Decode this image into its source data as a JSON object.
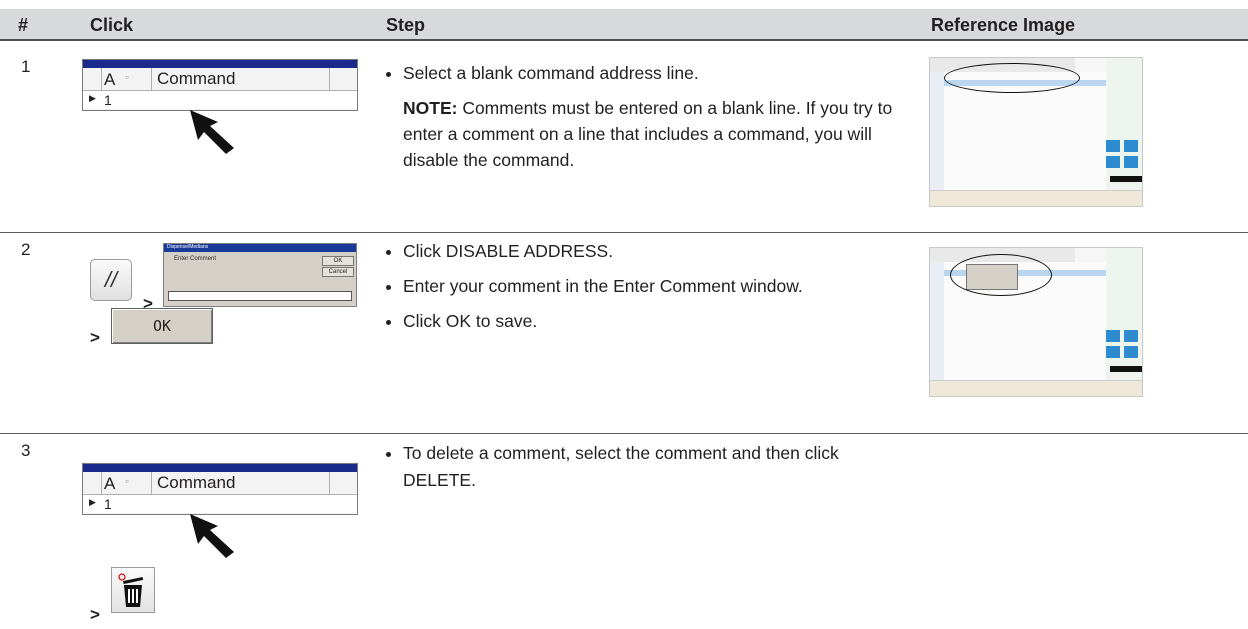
{
  "header": {
    "col_num": "#",
    "col_click": "Click",
    "col_step": "Step",
    "col_ref": "Reference Image"
  },
  "rows": [
    {
      "num": "1",
      "grid": {
        "col_a": "A",
        "col_cmd": "Command",
        "row_val": "1"
      },
      "bullets": [
        "Select a blank command address line."
      ],
      "note_label": "NOTE:",
      "note_text": " Comments must be entered on a blank line. If you try to enter a comment on a line that includes a command, you will disable the command."
    },
    {
      "num": "2",
      "button_symbol": "//",
      "dialog": {
        "title": "Dispense/Medians",
        "label": "Enter Comment",
        "ok": "OK",
        "cancel": "Cancel"
      },
      "ok_button": "OK",
      "gt": ">",
      "bullets": [
        "Click DISABLE ADDRESS.",
        "Enter your comment in the Enter Comment window.",
        "Click OK to save."
      ]
    },
    {
      "num": "3",
      "grid": {
        "col_a": "A",
        "col_cmd": "Command",
        "row_val": "1"
      },
      "gt": ">",
      "bullets": [
        "To delete a comment, select the comment and then click DELETE."
      ]
    }
  ]
}
